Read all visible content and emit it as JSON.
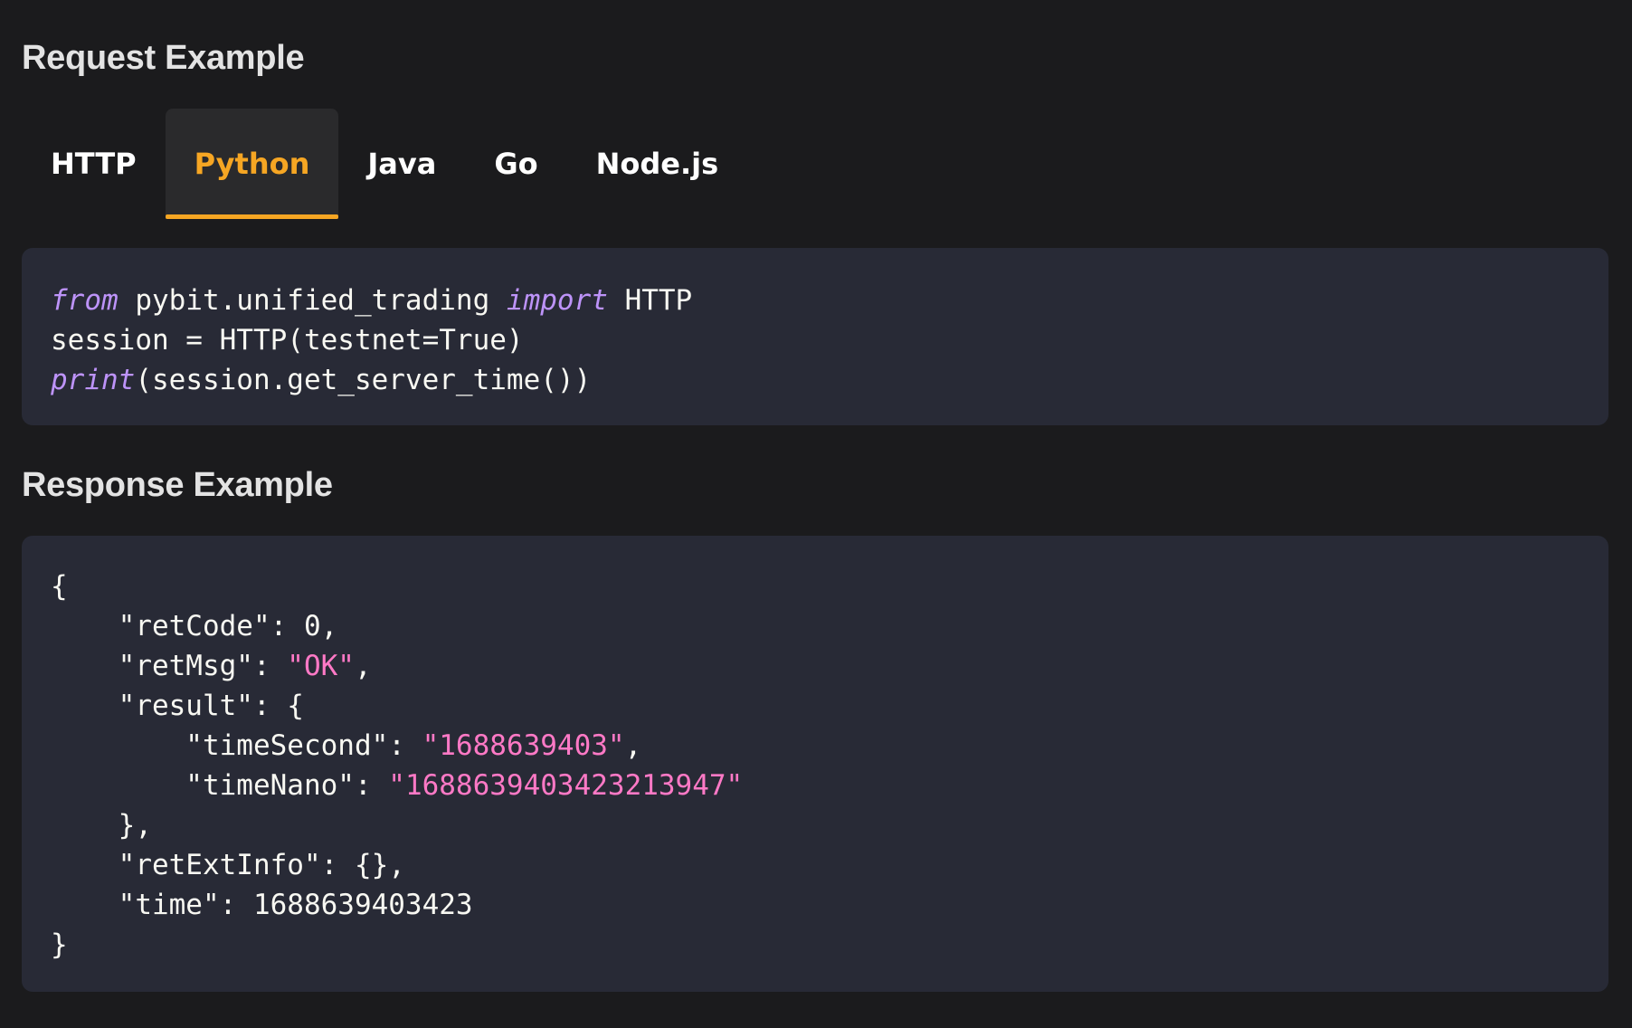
{
  "request_section": {
    "title": "Request Example",
    "tabs": [
      {
        "label": "HTTP",
        "active": false
      },
      {
        "label": "Python",
        "active": true
      },
      {
        "label": "Java",
        "active": false
      },
      {
        "label": "Go",
        "active": false
      },
      {
        "label": "Node.js",
        "active": false
      }
    ],
    "code": {
      "line1": {
        "kw1": "from",
        "t1": " pybit.unified_trading ",
        "kw2": "import",
        "t2": " HTTP"
      },
      "line2": "session = HTTP(testnet=True)",
      "line3": {
        "kw": "print",
        "text": "(session.get_server_time())"
      }
    }
  },
  "response_section": {
    "title": "Response Example",
    "lines": {
      "l1": "{",
      "l2": "    \"retCode\": 0,",
      "l3_key": "    \"retMsg\": ",
      "l3_val": "\"OK\"",
      "l3_end": ",",
      "l4": "    \"result\": {",
      "l5_key": "        \"timeSecond\": ",
      "l5_val": "\"1688639403\"",
      "l5_end": ",",
      "l6_key": "        \"timeNano\": ",
      "l6_val": "\"1688639403423213947\"",
      "l7": "    },",
      "l8": "    \"retExtInfo\": {},",
      "l9": "    \"time\": 1688639403423",
      "l10": "}"
    }
  },
  "colors": {
    "background": "#1b1b1d",
    "code_background": "#282a36",
    "accent": "#f6a623",
    "keyword": "#bd93f9",
    "string": "#ff79c6"
  }
}
